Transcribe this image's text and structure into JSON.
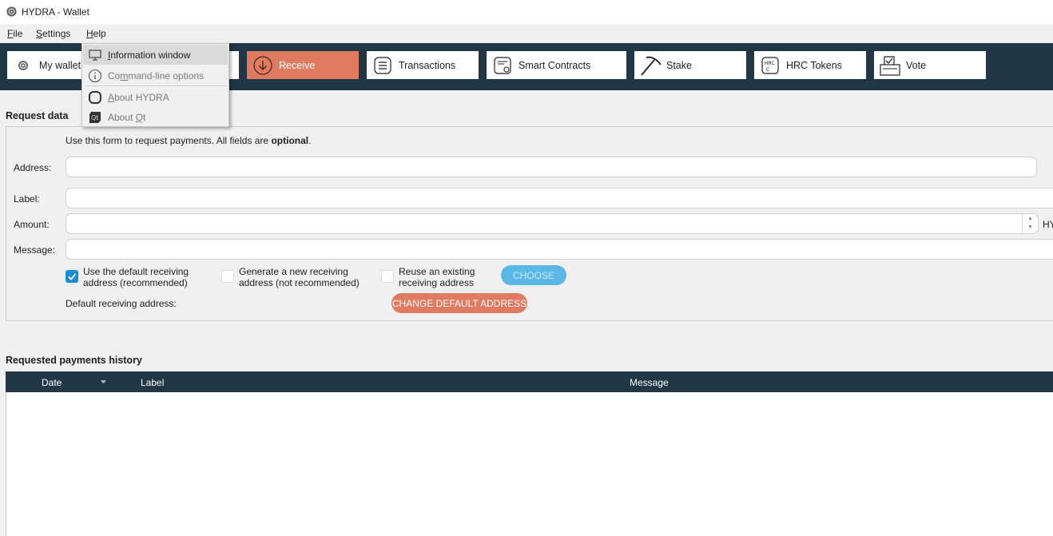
{
  "window": {
    "title": "HYDRA - Wallet"
  },
  "menubar": {
    "file": {
      "mnemonic": "F",
      "rest": "ile"
    },
    "settings": {
      "mnemonic": "S",
      "rest": "ettings"
    },
    "help": {
      "mnemonic": "H",
      "rest": "elp"
    }
  },
  "toolbar": {
    "my_wallet": "My wallet",
    "receive": "Receive",
    "transactions": "Transactions",
    "smart_contracts": "Smart Contracts",
    "stake": "Stake",
    "hrc_tokens": "HRC Tokens",
    "vote": "Vote",
    "active_color": "#e07a60",
    "bar_color": "#213746"
  },
  "help_menu": {
    "items": [
      {
        "mnemonic": "I",
        "rest": "nformation window",
        "icon": "monitor-icon"
      },
      {
        "pre": "Co",
        "mnemonic": "m",
        "rest": "mand-line options",
        "icon": "info-icon"
      },
      {
        "pre": "",
        "mnemonic": "A",
        "rest": "bout HYDRA",
        "icon": "hydra-logo-icon"
      },
      {
        "pre": "About ",
        "mnemonic": "Q",
        "rest": "t",
        "icon": "qt-logo-icon"
      }
    ]
  },
  "request_data": {
    "title": "Request data",
    "intro_prefix": "Use this form to request payments. All fields are ",
    "intro_bold": "optional",
    "intro_suffix": ".",
    "address_label": "Address:",
    "label_label": "Label:",
    "amount_label": "Amount:",
    "amount_unit": "HY",
    "message_label": "Message:",
    "address_value": "",
    "label_value": "",
    "amount_value": "",
    "message_value": "",
    "option_default": {
      "line1": "Use the default receiving",
      "line2": "address (recommended)",
      "checked": true
    },
    "option_new": {
      "line1": "Generate a new receiving",
      "line2": "address (not recommended)",
      "checked": false
    },
    "option_reuse": {
      "line1": "Reuse an existing",
      "line2": "receiving address",
      "checked": false
    },
    "choose_button": "CHOOSE",
    "default_address_label": "Default receiving address:",
    "change_default_button": "CHANGE DEFAULT ADDRESS"
  },
  "history": {
    "title": "Requested payments history",
    "columns": [
      "Date",
      "Label",
      "Message"
    ],
    "rows": []
  }
}
